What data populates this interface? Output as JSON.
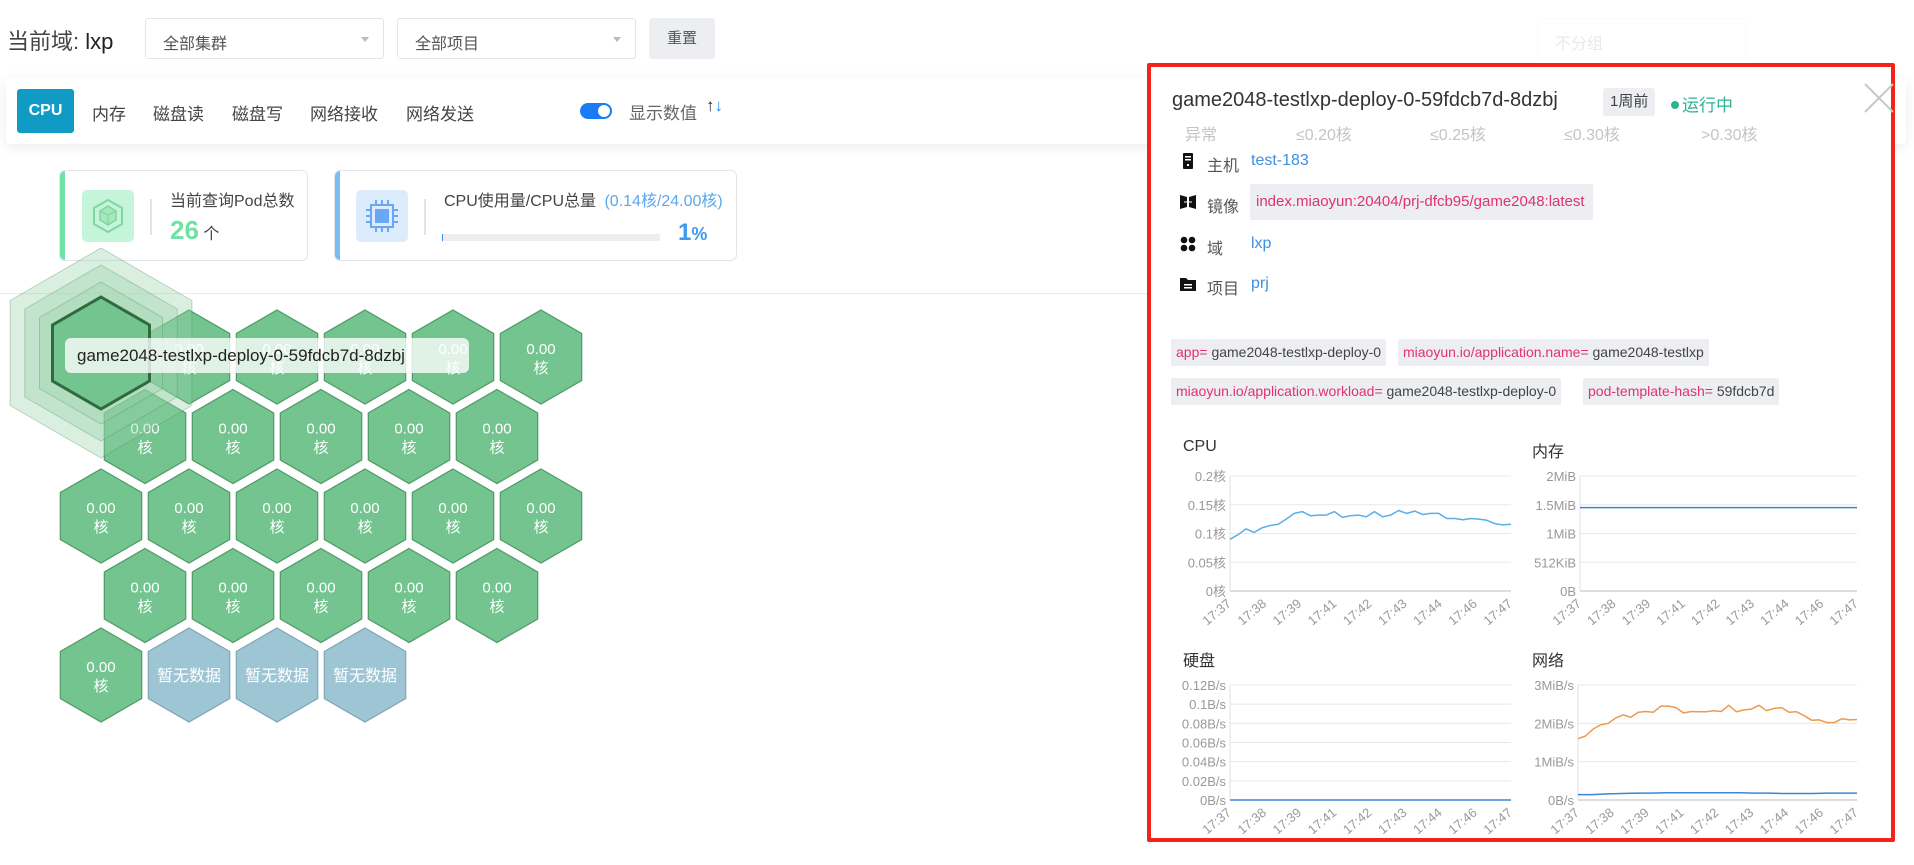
{
  "header": {
    "domain_label": "当前域:",
    "domain_value": "lxp",
    "cluster_select": "全部集群",
    "project_select": "全部项目",
    "reset_label": "重置",
    "group_select": "不分组"
  },
  "toolbar": {
    "tabs": [
      "CPU",
      "内存",
      "磁盘读",
      "磁盘写",
      "网络接收",
      "网络发送"
    ],
    "active_tab": "CPU",
    "show_values_label": "显示数值",
    "show_values_on": true,
    "sort_up": "↑",
    "sort_down": "↓"
  },
  "legend_faint": [
    "异常",
    "≤0.20核",
    "≤0.25核",
    "≤0.30核",
    ">0.30核"
  ],
  "stats": {
    "pod_count_title": "当前查询Pod总数",
    "pod_count": "26",
    "pod_count_unit": "个",
    "cpu_title": "CPU使用量/CPU总量",
    "cpu_detail": "(0.14核/24.00核)",
    "cpu_percent_label": "1",
    "cpu_percent_unit": "%",
    "cpu_percent": 0.6
  },
  "colors": {
    "accent": "#0f9bc4",
    "hex_ok": "#73c48f",
    "hex_nodata": "#9ec5d3",
    "highlight_border": "#f4221a",
    "running": "#2bb591",
    "tag_key": "#e0336b"
  },
  "pods": [
    "0.00",
    "0.00",
    "0.00",
    "0.00",
    "0.00",
    "0.00",
    "0.00",
    "0.00",
    "0.00",
    "0.00",
    "0.00",
    "0.00",
    "0.00",
    "0.00",
    "0.00",
    "0.00",
    "0.00",
    "0.00",
    "0.00",
    "0.00",
    "0.00",
    "0.00",
    "0.00",
    null,
    null,
    null
  ],
  "pod_unit": "核",
  "pod_no_data": "暂无数据",
  "hovered_pod": "game2048-testlxp-deploy-0-59fdcb7d-8dzbj",
  "detail": {
    "title": "game2048-testlxp-deploy-0-59fdcb7d-8dzbj",
    "age": "1周前",
    "status": "运行中",
    "host_label": "主机",
    "host": "test-183",
    "image_label": "镜像",
    "image": "index.miaoyun:20404/prj-dfcb95/game2048:latest",
    "domain_label": "域",
    "domain": "lxp",
    "project_label": "项目",
    "project": "prj",
    "tags": [
      {
        "key": "app=",
        "value": "game2048-testlxp-deploy-0"
      },
      {
        "key": "miaoyun.io/application.name=",
        "value": "game2048-testlxp"
      },
      {
        "key": "miaoyun.io/application.workload=",
        "value": "game2048-testlxp-deploy-0"
      },
      {
        "key": "pod-template-hash=",
        "value": "59fdcb7d"
      }
    ]
  },
  "chart_data": [
    {
      "type": "line",
      "title": "CPU",
      "x": [
        "17:37",
        "17:38",
        "17:39",
        "17:41",
        "17:42",
        "17:43",
        "17:44",
        "17:46",
        "17:47"
      ],
      "y_ticks": [
        "0核",
        "0.05核",
        "0.1核",
        "0.15核",
        "0.2核"
      ],
      "y_tick_values": [
        0,
        0.05,
        0.1,
        0.15,
        0.2
      ],
      "ylim": [
        0,
        0.2
      ],
      "grid": true,
      "series": [
        {
          "color": "#5aaeea",
          "values": [
            0.09,
            0.098,
            0.108,
            0.102,
            0.11,
            0.114,
            0.116,
            0.125,
            0.135,
            0.138,
            0.131,
            0.132,
            0.132,
            0.138,
            0.128,
            0.131,
            0.132,
            0.129,
            0.138,
            0.129,
            0.132,
            0.14,
            0.135,
            0.139,
            0.133,
            0.135,
            0.135,
            0.126,
            0.126,
            0.124,
            0.126,
            0.125,
            0.123,
            0.117,
            0.115,
            0.116
          ]
        }
      ]
    },
    {
      "type": "line",
      "title": "内存",
      "x": [
        "17:37",
        "17:38",
        "17:39",
        "17:41",
        "17:42",
        "17:43",
        "17:44",
        "17:46",
        "17:47"
      ],
      "y_ticks": [
        "0B",
        "512KiB",
        "1MiB",
        "1.5MiB",
        "2MiB"
      ],
      "y_tick_values": [
        0,
        0.5,
        1,
        1.5,
        2
      ],
      "ylim": [
        0,
        2
      ],
      "grid": true,
      "series": [
        {
          "color": "#3b86d4",
          "values": [
            1.45,
            1.45,
            1.45,
            1.45,
            1.45,
            1.45,
            1.45,
            1.45,
            1.45,
            1.45
          ]
        }
      ]
    },
    {
      "type": "line",
      "title": "硬盘",
      "x": [
        "17:37",
        "17:38",
        "17:39",
        "17:41",
        "17:42",
        "17:43",
        "17:44",
        "17:46",
        "17:47"
      ],
      "y_ticks": [
        "0B/s",
        "0.02B/s",
        "0.04B/s",
        "0.06B/s",
        "0.08B/s",
        "0.1B/s",
        "0.12B/s"
      ],
      "y_tick_values": [
        0,
        0.02,
        0.04,
        0.06,
        0.08,
        0.1,
        0.12
      ],
      "ylim": [
        0,
        0.12
      ],
      "grid": true,
      "series": [
        {
          "color": "#3b86d4",
          "values": [
            0,
            0,
            0,
            0,
            0,
            0,
            0,
            0,
            0,
            0
          ]
        }
      ]
    },
    {
      "type": "line",
      "title": "网络",
      "x": [
        "17:37",
        "17:38",
        "17:39",
        "17:41",
        "17:42",
        "17:43",
        "17:44",
        "17:46",
        "17:47"
      ],
      "y_ticks": [
        "0B/s",
        "1MiB/s",
        "2MiB/s",
        "3MiB/s"
      ],
      "y_tick_values": [
        0,
        1,
        2,
        3
      ],
      "ylim": [
        0,
        3
      ],
      "grid": true,
      "series": [
        {
          "color": "#ee9a4d",
          "values": [
            1.6,
            1.67,
            1.85,
            1.96,
            2.0,
            2.14,
            2.22,
            2.16,
            2.29,
            2.31,
            2.29,
            2.45,
            2.45,
            2.41,
            2.27,
            2.31,
            2.3,
            2.3,
            2.33,
            2.31,
            2.47,
            2.3,
            2.35,
            2.37,
            2.47,
            2.33,
            2.39,
            2.41,
            2.29,
            2.3,
            2.2,
            2.08,
            2.09,
            2.02,
            2.02,
            2.12,
            2.09,
            2.1
          ]
        },
        {
          "color": "#3b86d4",
          "values": [
            0.14,
            0.14,
            0.16,
            0.17,
            0.18,
            0.18,
            0.19,
            0.19,
            0.19,
            0.19,
            0.19,
            0.19,
            0.18,
            0.18,
            0.17,
            0.17,
            0.17,
            0.18,
            0.18,
            0.18
          ]
        }
      ]
    }
  ]
}
